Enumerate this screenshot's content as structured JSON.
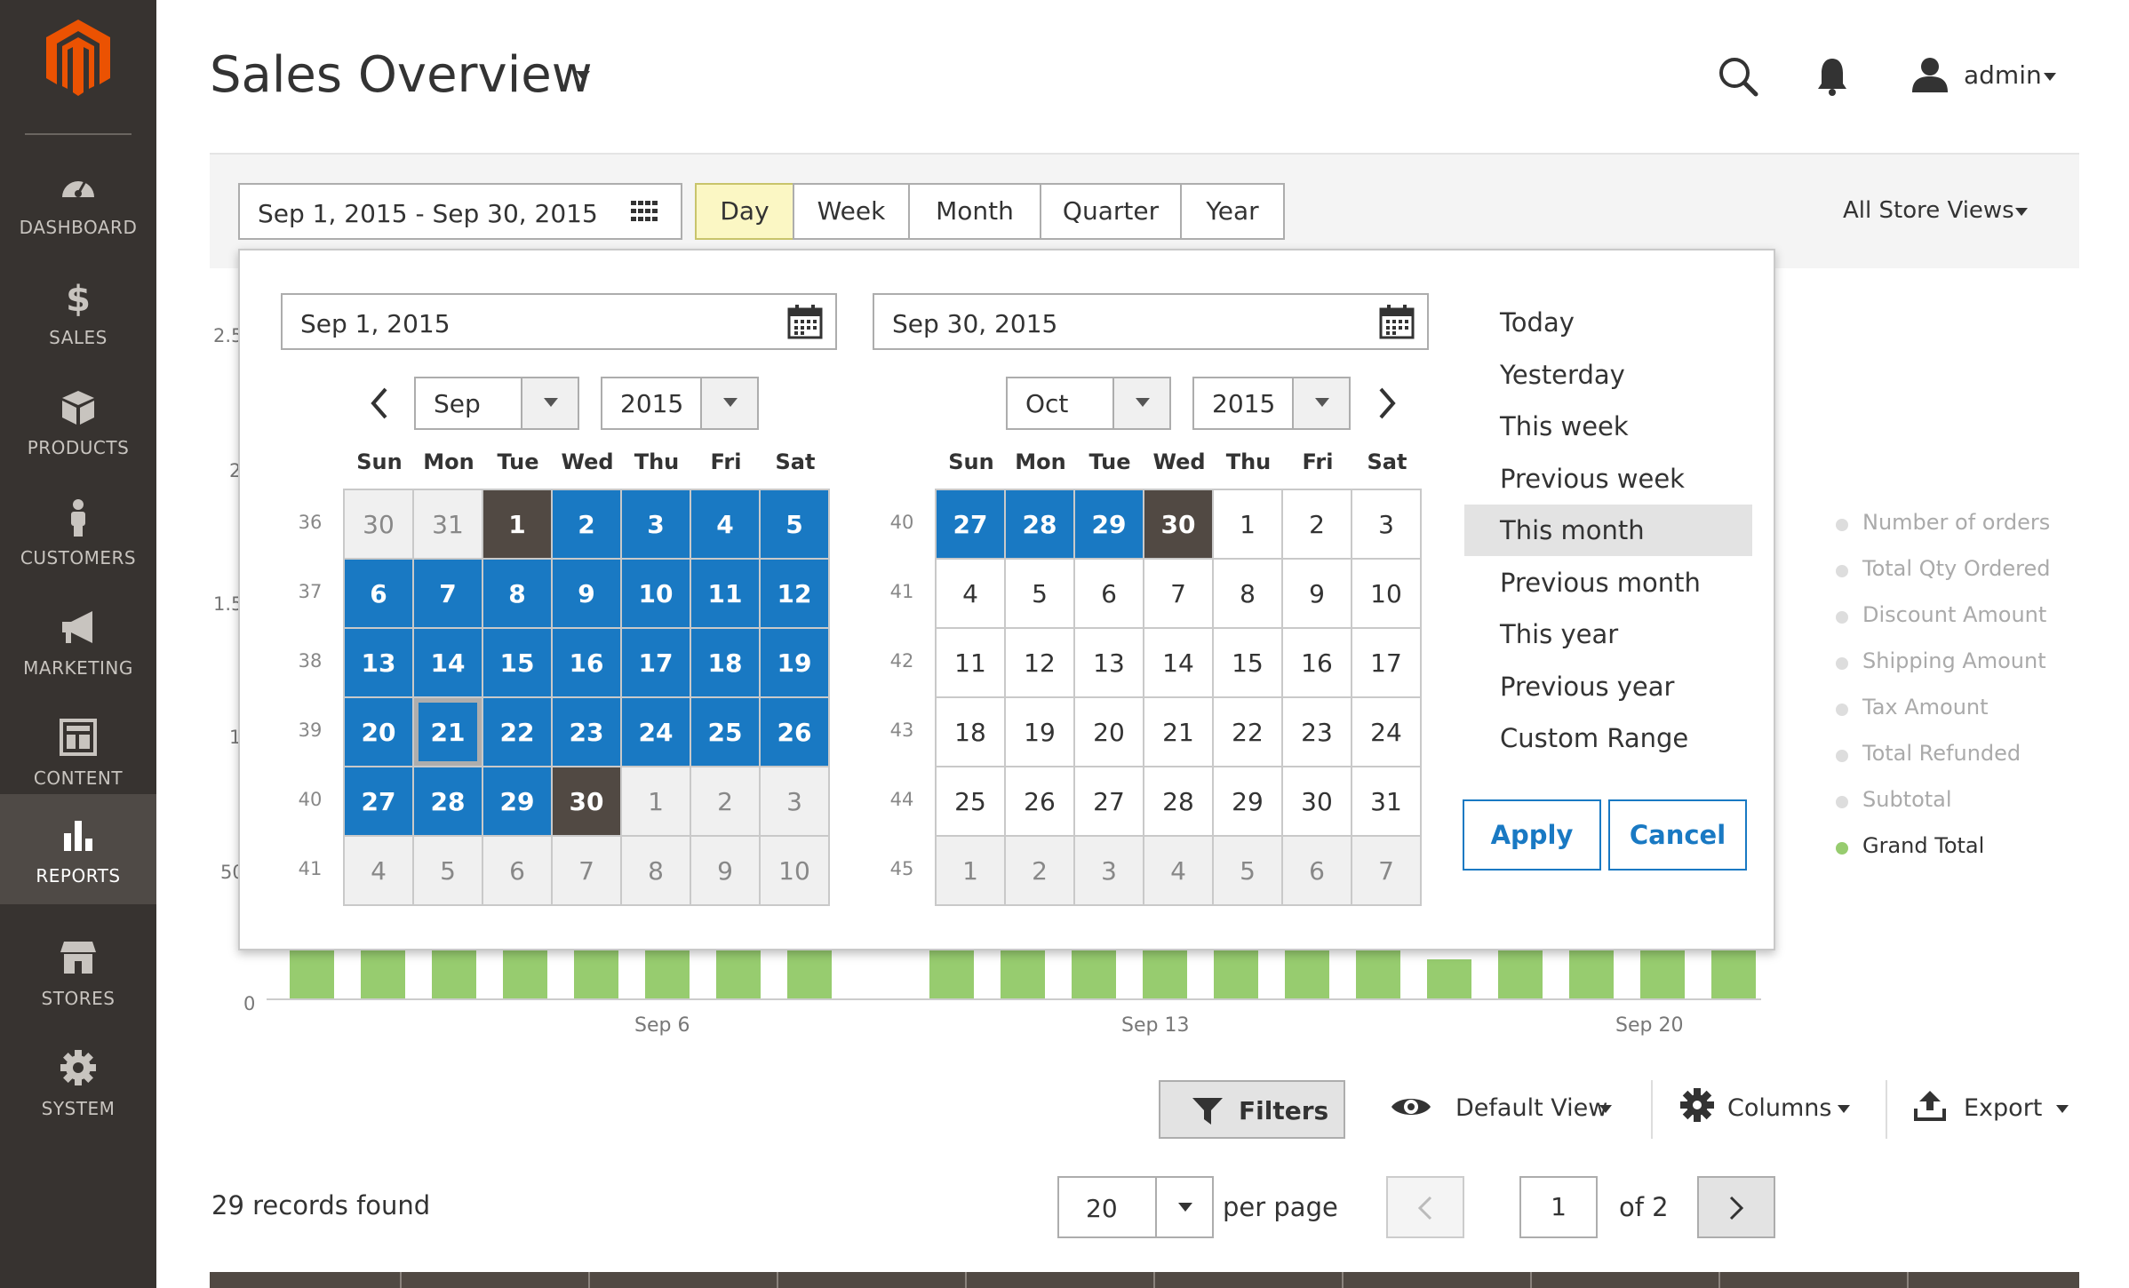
{
  "sidebar": {
    "items": [
      {
        "label": "DASHBOARD",
        "icon": "dashboard-icon"
      },
      {
        "label": "SALES",
        "icon": "dollar-icon"
      },
      {
        "label": "PRODUCTS",
        "icon": "cube-icon"
      },
      {
        "label": "CUSTOMERS",
        "icon": "person-icon"
      },
      {
        "label": "MARKETING",
        "icon": "megaphone-icon"
      },
      {
        "label": "CONTENT",
        "icon": "layout-icon"
      },
      {
        "label": "REPORTS",
        "icon": "bar-chart-icon"
      },
      {
        "label": "STORES",
        "icon": "storefront-icon"
      },
      {
        "label": "SYSTEM",
        "icon": "gear-icon"
      }
    ],
    "active": "REPORTS"
  },
  "header": {
    "title": "Sales Overview",
    "user": "admin"
  },
  "toolbar": {
    "date_range": "Sep 1, 2015 - Sep 30, 2015",
    "periods": [
      "Day",
      "Week",
      "Month",
      "Quarter",
      "Year"
    ],
    "active_period": "Day",
    "store_views": "All Store Views"
  },
  "chart": {
    "y_ticks": [
      "2.5",
      "2",
      "1.5",
      "1",
      "50",
      "0"
    ],
    "x_ticks": [
      "Sep 6",
      "Sep 13",
      "Sep 20"
    ],
    "legend": [
      {
        "label": "Number of orders",
        "color": "#dddddd"
      },
      {
        "label": "Total Qty Ordered",
        "color": "#dddddd"
      },
      {
        "label": "Discount Amount",
        "color": "#dddddd"
      },
      {
        "label": "Shipping Amount",
        "color": "#dddddd"
      },
      {
        "label": "Tax Amount",
        "color": "#dddddd"
      },
      {
        "label": "Total Refunded",
        "color": "#dddddd"
      },
      {
        "label": "Subtotal",
        "color": "#dddddd"
      },
      {
        "label": "Grand Total",
        "color": "#97cc6f"
      }
    ]
  },
  "datepicker": {
    "from_value": "Sep 1, 2015",
    "to_value": "Sep 30, 2015",
    "weekdays": [
      "Sun",
      "Mon",
      "Tue",
      "Wed",
      "Thu",
      "Fri",
      "Sat"
    ],
    "left": {
      "month": "Sep",
      "year": "2015",
      "weeks": [
        "36",
        "37",
        "38",
        "39",
        "40",
        "41"
      ],
      "days": [
        [
          "30",
          "31",
          "1",
          "2",
          "3",
          "4",
          "5"
        ],
        [
          "6",
          "7",
          "8",
          "9",
          "10",
          "11",
          "12"
        ],
        [
          "13",
          "14",
          "15",
          "16",
          "17",
          "18",
          "19"
        ],
        [
          "20",
          "21",
          "22",
          "23",
          "24",
          "25",
          "26"
        ],
        [
          "27",
          "28",
          "29",
          "30",
          "1",
          "2",
          "3"
        ],
        [
          "4",
          "5",
          "6",
          "7",
          "8",
          "9",
          "10"
        ]
      ]
    },
    "right": {
      "month": "Oct",
      "year": "2015",
      "weeks": [
        "40",
        "41",
        "42",
        "43",
        "44",
        "45"
      ],
      "days": [
        [
          "27",
          "28",
          "29",
          "30",
          "1",
          "2",
          "3"
        ],
        [
          "4",
          "5",
          "6",
          "7",
          "8",
          "9",
          "10"
        ],
        [
          "11",
          "12",
          "13",
          "14",
          "15",
          "16",
          "17"
        ],
        [
          "18",
          "19",
          "20",
          "21",
          "22",
          "23",
          "24"
        ],
        [
          "25",
          "26",
          "27",
          "28",
          "29",
          "30",
          "31"
        ],
        [
          "1",
          "2",
          "3",
          "4",
          "5",
          "6",
          "7"
        ]
      ]
    },
    "quick_ranges": [
      "Today",
      "Yesterday",
      "This week",
      "Previous week",
      "This month",
      "Previous month",
      "This year",
      "Previous year",
      "Custom Range"
    ],
    "active_range": "This month",
    "apply_label": "Apply",
    "cancel_label": "Cancel"
  },
  "grid_controls": {
    "filters_label": "Filters",
    "view_label": "Default View",
    "columns_label": "Columns",
    "export_label": "Export",
    "records_found": "29 records found",
    "per_page_value": "20",
    "per_page_label": "per page",
    "current_page": "1",
    "page_of": "of 2"
  },
  "colors": {
    "sidebar_bg": "#373330",
    "selected_day": "#1979c3",
    "range_edge": "#514943",
    "logo": "#eb5202",
    "bar": "#97cc6f"
  }
}
